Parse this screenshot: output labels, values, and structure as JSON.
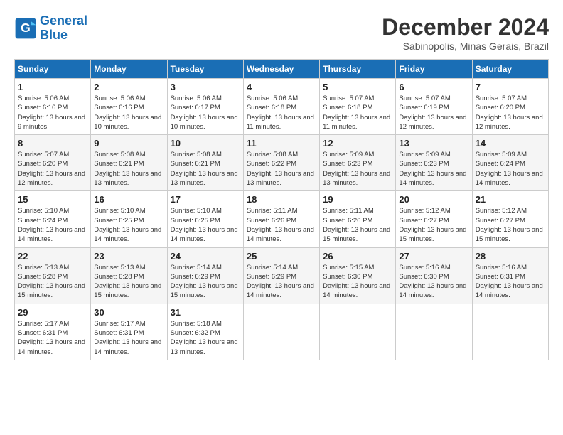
{
  "logo": {
    "line1": "General",
    "line2": "Blue"
  },
  "title": "December 2024",
  "location": "Sabinopolis, Minas Gerais, Brazil",
  "days_of_week": [
    "Sunday",
    "Monday",
    "Tuesday",
    "Wednesday",
    "Thursday",
    "Friday",
    "Saturday"
  ],
  "weeks": [
    [
      {
        "day": "1",
        "sunrise": "5:06 AM",
        "sunset": "6:16 PM",
        "daylight": "13 hours and 9 minutes."
      },
      {
        "day": "2",
        "sunrise": "5:06 AM",
        "sunset": "6:16 PM",
        "daylight": "13 hours and 10 minutes."
      },
      {
        "day": "3",
        "sunrise": "5:06 AM",
        "sunset": "6:17 PM",
        "daylight": "13 hours and 10 minutes."
      },
      {
        "day": "4",
        "sunrise": "5:06 AM",
        "sunset": "6:18 PM",
        "daylight": "13 hours and 11 minutes."
      },
      {
        "day": "5",
        "sunrise": "5:07 AM",
        "sunset": "6:18 PM",
        "daylight": "13 hours and 11 minutes."
      },
      {
        "day": "6",
        "sunrise": "5:07 AM",
        "sunset": "6:19 PM",
        "daylight": "13 hours and 12 minutes."
      },
      {
        "day": "7",
        "sunrise": "5:07 AM",
        "sunset": "6:20 PM",
        "daylight": "13 hours and 12 minutes."
      }
    ],
    [
      {
        "day": "8",
        "sunrise": "5:07 AM",
        "sunset": "6:20 PM",
        "daylight": "13 hours and 12 minutes."
      },
      {
        "day": "9",
        "sunrise": "5:08 AM",
        "sunset": "6:21 PM",
        "daylight": "13 hours and 13 minutes."
      },
      {
        "day": "10",
        "sunrise": "5:08 AM",
        "sunset": "6:21 PM",
        "daylight": "13 hours and 13 minutes."
      },
      {
        "day": "11",
        "sunrise": "5:08 AM",
        "sunset": "6:22 PM",
        "daylight": "13 hours and 13 minutes."
      },
      {
        "day": "12",
        "sunrise": "5:09 AM",
        "sunset": "6:23 PM",
        "daylight": "13 hours and 13 minutes."
      },
      {
        "day": "13",
        "sunrise": "5:09 AM",
        "sunset": "6:23 PM",
        "daylight": "13 hours and 14 minutes."
      },
      {
        "day": "14",
        "sunrise": "5:09 AM",
        "sunset": "6:24 PM",
        "daylight": "13 hours and 14 minutes."
      }
    ],
    [
      {
        "day": "15",
        "sunrise": "5:10 AM",
        "sunset": "6:24 PM",
        "daylight": "13 hours and 14 minutes."
      },
      {
        "day": "16",
        "sunrise": "5:10 AM",
        "sunset": "6:25 PM",
        "daylight": "13 hours and 14 minutes."
      },
      {
        "day": "17",
        "sunrise": "5:10 AM",
        "sunset": "6:25 PM",
        "daylight": "13 hours and 14 minutes."
      },
      {
        "day": "18",
        "sunrise": "5:11 AM",
        "sunset": "6:26 PM",
        "daylight": "13 hours and 14 minutes."
      },
      {
        "day": "19",
        "sunrise": "5:11 AM",
        "sunset": "6:26 PM",
        "daylight": "13 hours and 15 minutes."
      },
      {
        "day": "20",
        "sunrise": "5:12 AM",
        "sunset": "6:27 PM",
        "daylight": "13 hours and 15 minutes."
      },
      {
        "day": "21",
        "sunrise": "5:12 AM",
        "sunset": "6:27 PM",
        "daylight": "13 hours and 15 minutes."
      }
    ],
    [
      {
        "day": "22",
        "sunrise": "5:13 AM",
        "sunset": "6:28 PM",
        "daylight": "13 hours and 15 minutes."
      },
      {
        "day": "23",
        "sunrise": "5:13 AM",
        "sunset": "6:28 PM",
        "daylight": "13 hours and 15 minutes."
      },
      {
        "day": "24",
        "sunrise": "5:14 AM",
        "sunset": "6:29 PM",
        "daylight": "13 hours and 15 minutes."
      },
      {
        "day": "25",
        "sunrise": "5:14 AM",
        "sunset": "6:29 PM",
        "daylight": "13 hours and 14 minutes."
      },
      {
        "day": "26",
        "sunrise": "5:15 AM",
        "sunset": "6:30 PM",
        "daylight": "13 hours and 14 minutes."
      },
      {
        "day": "27",
        "sunrise": "5:16 AM",
        "sunset": "6:30 PM",
        "daylight": "13 hours and 14 minutes."
      },
      {
        "day": "28",
        "sunrise": "5:16 AM",
        "sunset": "6:31 PM",
        "daylight": "13 hours and 14 minutes."
      }
    ],
    [
      {
        "day": "29",
        "sunrise": "5:17 AM",
        "sunset": "6:31 PM",
        "daylight": "13 hours and 14 minutes."
      },
      {
        "day": "30",
        "sunrise": "5:17 AM",
        "sunset": "6:31 PM",
        "daylight": "13 hours and 14 minutes."
      },
      {
        "day": "31",
        "sunrise": "5:18 AM",
        "sunset": "6:32 PM",
        "daylight": "13 hours and 13 minutes."
      },
      null,
      null,
      null,
      null
    ]
  ]
}
